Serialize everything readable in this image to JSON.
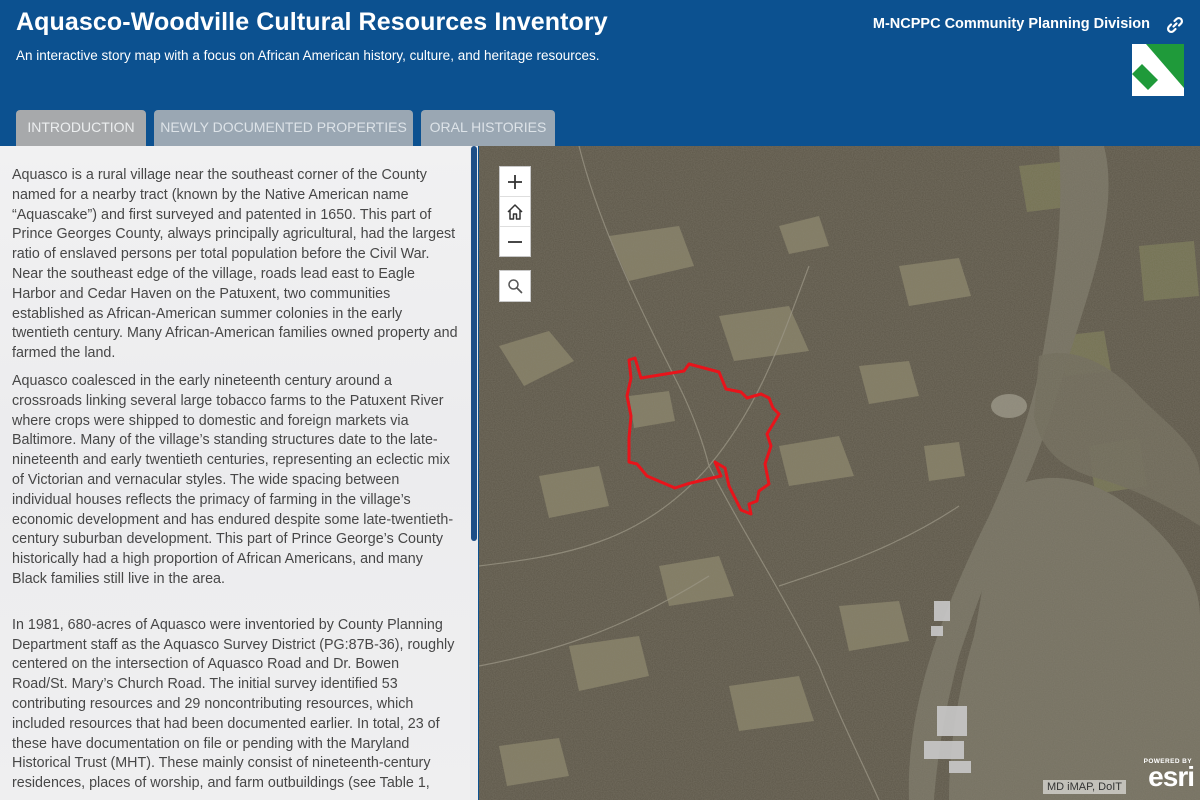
{
  "header": {
    "title": "Aquasco-Woodville Cultural Resources Inventory",
    "subtitle": "An interactive story map with a focus on African American history, culture, and heritage resources.",
    "organization": "M-NCPPC Community Planning Division",
    "logo_icon": "mncppc-logo-icon",
    "share_icon": "link-icon",
    "colors": {
      "header_bg": "#0c5190",
      "logo_green": "#1f9a3a"
    }
  },
  "tabs": [
    {
      "label": "INTRODUCTION",
      "active": true
    },
    {
      "label": "NEWLY DOCUMENTED PROPERTIES",
      "active": false
    },
    {
      "label": "ORAL HISTORIES",
      "active": false
    }
  ],
  "narrative": {
    "paragraphs": [
      "Aquasco is a rural village near the southeast corner of the County named for a nearby tract (known by the Native American name “Aquascake”) and first surveyed and patented in 1650. This part of Prince Georges County, always principally agricultural, had the largest ratio of enslaved persons per total population before the Civil War. Near the southeast edge of the village, roads lead east to Eagle Harbor and Cedar Haven on the Patuxent, two communities established as African-American summer colonies in the early twentieth century. Many African-American families owned property and farmed the land.",
      "Aquasco coalesced in the early nineteenth century around a crossroads linking several large tobacco farms to the Patuxent River where crops were shipped to domestic and foreign markets via Baltimore. Many of the village’s standing structures date to the late-nineteenth and early twentieth centuries, representing an eclectic mix of Victorian and vernacular styles. The wide spacing between individual houses reflects the primacy of farming in the village’s economic development and has endured despite some late-twentieth-century suburban development. This part of Prince George’s County historically had a high proportion of African Americans, and many Black families still live in the area.",
      "In 1981, 680-acres of Aquasco were inventoried by County Planning Department staff as the Aquasco Survey District (PG:87B-36), roughly centered on the intersection of Aquasco Road and Dr. Bowen Road/St. Mary’s Church Road. The initial survey identified 53 contributing resources and 29 noncontributing resources, which included resources that had been documented earlier. In total, 23 of these have documentation on file or pending with the Maryland Historical Trust (MHT). These mainly consist of nineteenth-century residences, places of worship, and farm outbuildings (see Table 1,"
    ]
  },
  "map": {
    "controls": {
      "zoom_in": "plus-icon",
      "home": "home-icon",
      "zoom_out": "minus-icon",
      "search": "search-icon"
    },
    "attribution": "MD iMAP, DoIT",
    "esri_badge": {
      "powered_by": "POWERED BY",
      "wordmark": "esri"
    },
    "boundary_color": "#e8141b"
  }
}
